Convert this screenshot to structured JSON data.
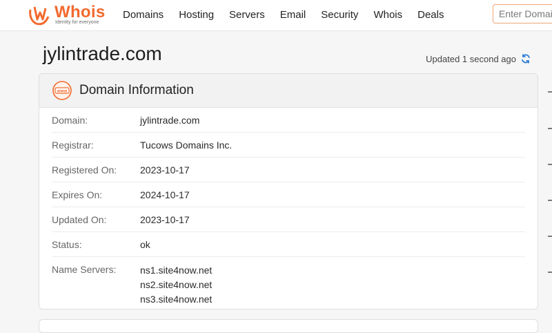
{
  "header": {
    "logo_text": "Whois",
    "logo_tagline": "Identity for everyone",
    "nav": [
      {
        "label": "Domains"
      },
      {
        "label": "Hosting"
      },
      {
        "label": "Servers"
      },
      {
        "label": "Email"
      },
      {
        "label": "Security"
      },
      {
        "label": "Whois"
      },
      {
        "label": "Deals"
      }
    ],
    "search_placeholder": "Enter Domain or IP"
  },
  "page": {
    "title": "jylintrade.com",
    "updated": "Updated 1 second ago"
  },
  "domain_info": {
    "title": "Domain Information",
    "icon_text": "www",
    "rows": [
      {
        "label": "Domain:",
        "value": "jylintrade.com"
      },
      {
        "label": "Registrar:",
        "value": "Tucows Domains Inc."
      },
      {
        "label": "Registered On:",
        "value": "2023-10-17"
      },
      {
        "label": "Expires On:",
        "value": "2024-10-17"
      },
      {
        "label": "Updated On:",
        "value": "2023-10-17"
      },
      {
        "label": "Status:",
        "value": "ok"
      }
    ],
    "name_servers_label": "Name Servers:",
    "name_servers": [
      "ns1.site4now.net",
      "ns2.site4now.net",
      "ns3.site4now.net"
    ]
  },
  "colors": {
    "brand_orange": "#f26a2e",
    "refresh_blue": "#2f7fd6"
  }
}
